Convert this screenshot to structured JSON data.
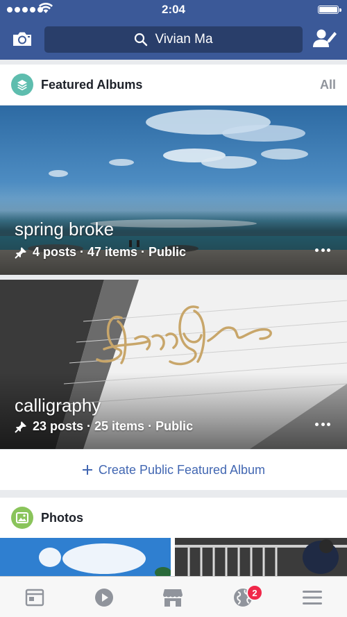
{
  "status_bar": {
    "time": "2:04"
  },
  "nav": {
    "search_text": "Vivian Ma",
    "icons": {
      "camera": "camera-icon",
      "search": "search-icon",
      "friend": "add-friend-icon"
    }
  },
  "featured": {
    "title": "Featured Albums",
    "all_label": "All",
    "albums": [
      {
        "name": "spring broke",
        "meta": "4 posts · 47 items · Public"
      },
      {
        "name": "calligraphy",
        "meta": "23 posts · 25 items · Public"
      }
    ],
    "create_label": "Create Public Featured Album"
  },
  "photos": {
    "title": "Photos"
  },
  "tabbar": {
    "items": [
      "news-feed-icon",
      "video-icon",
      "marketplace-icon",
      "notifications-globe-icon",
      "menu-icon"
    ],
    "notification_count": "2"
  },
  "colors": {
    "brand": "#3b5998",
    "link": "#4267b2",
    "badge_teal": "#5ebdae",
    "badge_green": "#8ac45b",
    "notif_red": "#f0284a"
  }
}
